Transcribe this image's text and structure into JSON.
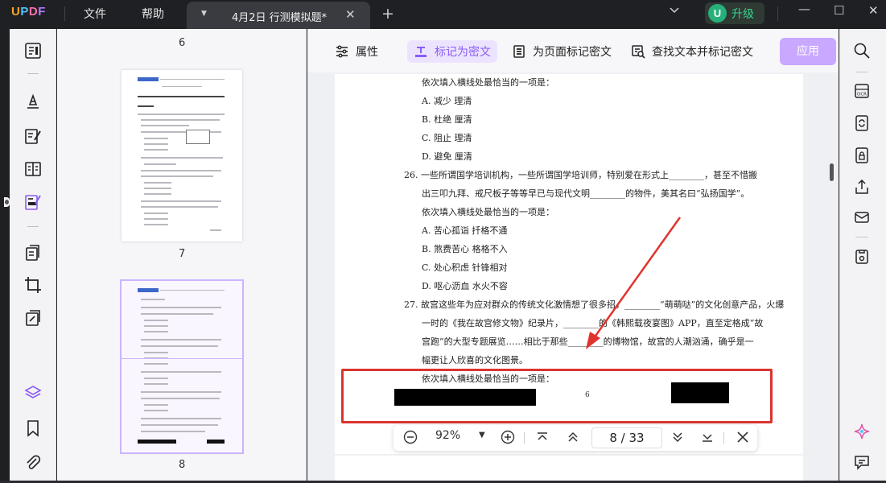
{
  "app": {
    "logo": "UPDF",
    "menu": [
      "文件",
      "帮助"
    ],
    "tab": {
      "title": "4月2日 行测模拟题*"
    },
    "user_initial": "U",
    "upgrade_label": "升级"
  },
  "thumbnails": {
    "top_page_label": "6",
    "pages": [
      {
        "label": "7",
        "selected": false
      },
      {
        "label": "8",
        "selected": true
      }
    ]
  },
  "toolbar": {
    "properties": "属性",
    "mark_redaction": "标记为密文",
    "mark_page": "为页面标记密文",
    "find_text": "查找文本并标记密文",
    "apply": "应用"
  },
  "document": {
    "lines": [
      "依次填入横线处最恰当的一项是：",
      "A.  减少    理清",
      "B.  杜绝    厘清",
      "C.  阻止    理清",
      "D.  避免    厘清",
      "26.  一些所谓国学培训机构，一些所谓国学培训师，特别爱在形式上________，甚至不惜搬",
      "出三叩九拜、戒尺板子等等早已与现代文明________的物件，美其名曰“弘扬国学”。",
      "依次填入横线处最恰当的一项是：",
      "A.  苦心孤诣    扦格不通",
      "B.  煞费苦心    格格不入",
      "C.  处心积虑    针锋相对",
      "D.  呕心沥血    水火不容",
      "27.  故宫这些年为应对群众的传统文化激情想了很多招，________“萌萌哒”的文化创意产品，火爆",
      "一时的《我在故宫修文物》纪录片，________的《韩熙载夜宴图》APP，直至定格成“故",
      "宫跑”的大型专题展览……相比于那些________的博物馆，故宫的人潮汹涌，确乎是一",
      "幅更让人欣喜的文化图景。",
      "依次填入横线处最恰当的一项是："
    ],
    "page_number": "6"
  },
  "zoom": {
    "level": "92%",
    "current_page": "8",
    "total_pages": "33",
    "page_display": "8 / 33"
  },
  "colors": {
    "accent": "#8a5cf5",
    "apply_button": "#c9a8ff",
    "highlight_box": "#d9352f",
    "arrow": "#e0342e",
    "upgrade_text": "#37d28f"
  },
  "icons": {
    "left_tools": [
      "reader-icon",
      "comment-icon",
      "edit-icon",
      "page-layout-icon",
      "redact-icon",
      "organize-pages-icon",
      "crop-icon",
      "protect-icon",
      "layers-icon",
      "bookmark-icon",
      "attachment-icon"
    ],
    "right_tools": [
      "search-icon",
      "ocr-icon",
      "convert-icon",
      "protect-password-icon",
      "share-icon",
      "email-icon",
      "save-icon",
      "ai-assistant-icon",
      "chat-icon"
    ]
  }
}
